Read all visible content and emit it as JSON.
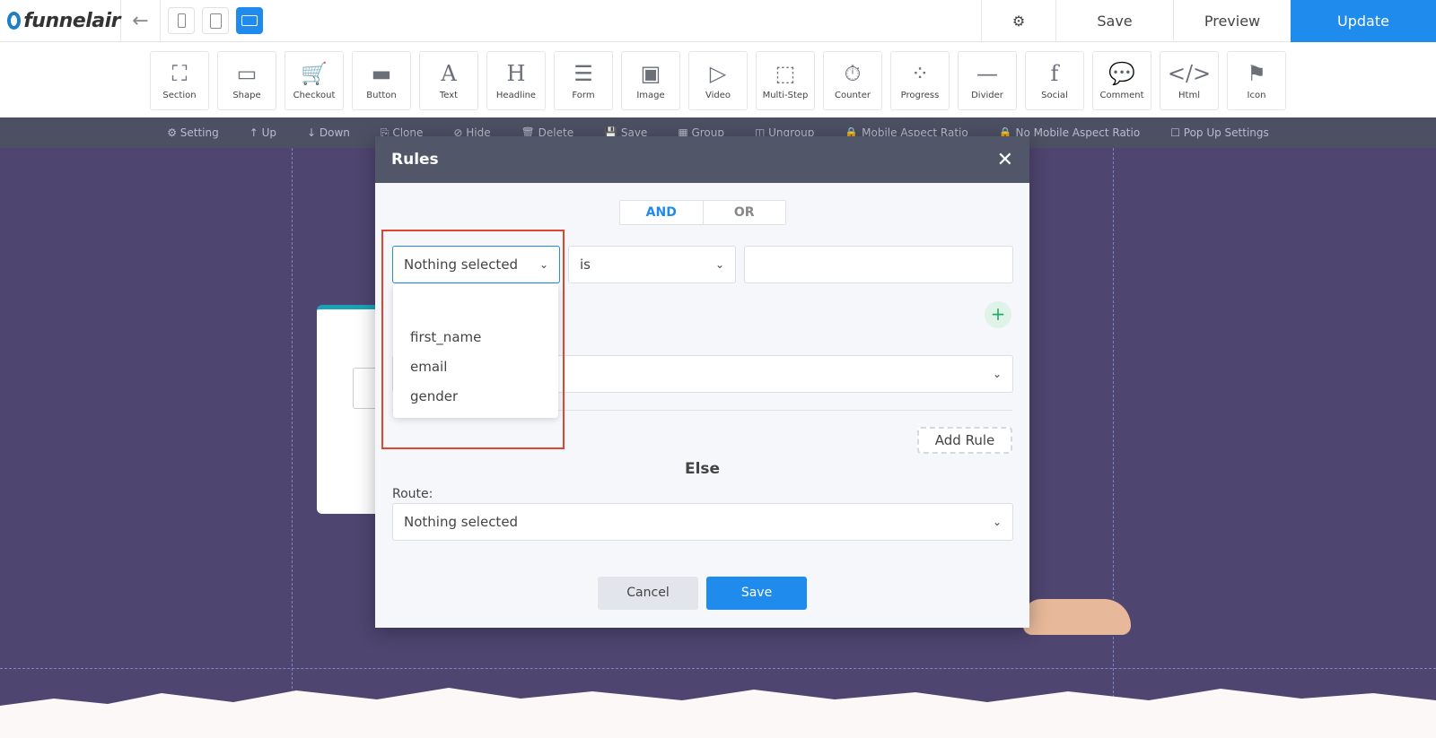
{
  "header": {
    "logo": "funnelair",
    "save": "Save",
    "preview": "Preview",
    "update": "Update"
  },
  "elements": [
    {
      "label": "Section",
      "icon": "section-icon",
      "glyph": "⛶"
    },
    {
      "label": "Shape",
      "icon": "shape-icon",
      "glyph": "▭"
    },
    {
      "label": "Checkout",
      "icon": "cart-icon",
      "glyph": "🛒"
    },
    {
      "label": "Button",
      "icon": "button-icon",
      "glyph": "▬"
    },
    {
      "label": "Text",
      "icon": "text-icon",
      "glyph": "A"
    },
    {
      "label": "Headline",
      "icon": "headline-icon",
      "glyph": "H"
    },
    {
      "label": "Form",
      "icon": "form-icon",
      "glyph": "☰"
    },
    {
      "label": "Image",
      "icon": "image-icon",
      "glyph": "▣"
    },
    {
      "label": "Video",
      "icon": "video-icon",
      "glyph": "▷"
    },
    {
      "label": "Multi-Step",
      "icon": "multistep-icon",
      "glyph": "⬚"
    },
    {
      "label": "Counter",
      "icon": "stopwatch-icon",
      "glyph": "⏱"
    },
    {
      "label": "Progress",
      "icon": "progress-icon",
      "glyph": "⁘"
    },
    {
      "label": "Divider",
      "icon": "divider-icon",
      "glyph": "—"
    },
    {
      "label": "Social",
      "icon": "facebook-icon",
      "glyph": "f"
    },
    {
      "label": "Comment",
      "icon": "comment-icon",
      "glyph": "💬"
    },
    {
      "label": "Html",
      "icon": "code-icon",
      "glyph": "</>"
    },
    {
      "label": "Icon",
      "icon": "flag-icon",
      "glyph": "⚑"
    }
  ],
  "actions": [
    "⚙ Setting",
    "↑ Up",
    "↓ Down",
    "⎘ Clone",
    "⊘ Hide",
    "🗑 Delete",
    "💾 Save",
    "▦ Group",
    "◫ Ungroup",
    "🔒 Mobile Aspect Ratio",
    "🔒 No Mobile Aspect Ratio",
    "☐ Pop Up Settings"
  ],
  "modal": {
    "title": "Rules",
    "close": "✕",
    "and": "AND",
    "or": "OR",
    "field": "Nothing selected",
    "operator": "is",
    "value": "",
    "field_options": [
      "first_name",
      "email",
      "gender"
    ],
    "add_rule": "Add Rule",
    "else": "Else",
    "route_label": "Route:",
    "route_value": "Nothing selected",
    "cancel": "Cancel",
    "save": "Save"
  },
  "colors": {
    "accent": "#1f8bec",
    "highlight": "#e0452f",
    "canvas": "#4e4570"
  }
}
